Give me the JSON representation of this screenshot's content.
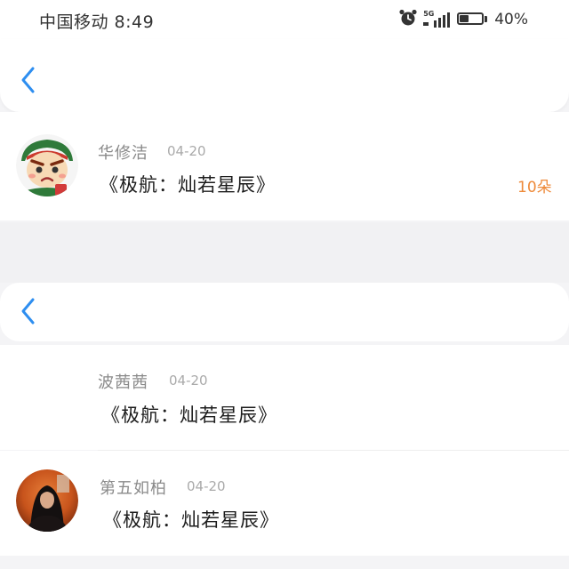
{
  "status_bar": {
    "carrier_time": "中国移动 8:49",
    "network": "5G",
    "battery_percent": "40%",
    "battery_level": 0.4
  },
  "header_top": {
    "back_icon": "chevron-left-icon"
  },
  "header_mid": {
    "back_icon": "chevron-left-icon"
  },
  "entries": [
    {
      "name": "华修洁",
      "date": "04-20",
      "title": "《极航：灿若星辰》",
      "count": "10朵"
    },
    {
      "name": "波茜茜",
      "date": "04-20",
      "title": "《极航：灿若星辰》"
    },
    {
      "name": "第五如柏",
      "date": "04-20",
      "title": "《极航：灿若星辰》"
    }
  ],
  "colors": {
    "accent_blue": "#2e8ef0",
    "count_orange": "#ee8a3a",
    "background": "#f4f4f6"
  }
}
